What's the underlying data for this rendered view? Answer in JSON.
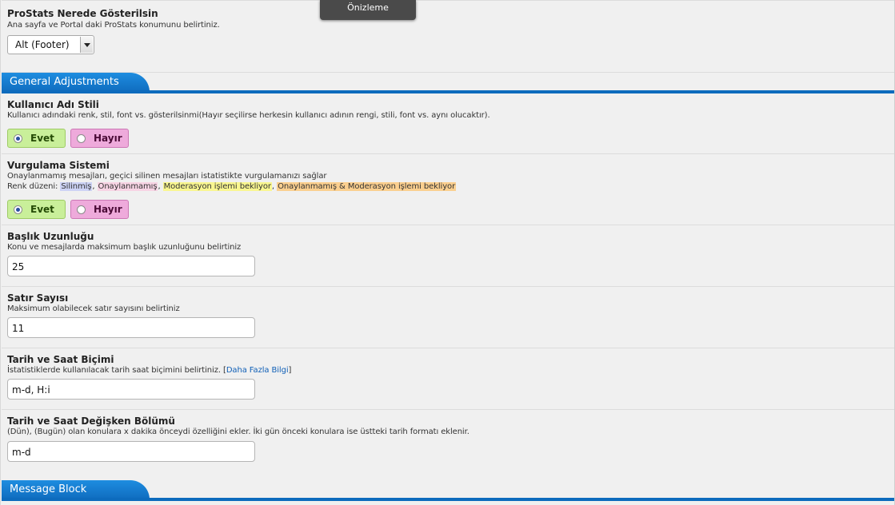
{
  "tooltip": {
    "label": "Önizleme"
  },
  "location_setting": {
    "title": "ProStats Nerede Gösterilsin",
    "desc": "Ana sayfa ve Portal daki ProStats konumunu belirtiniz.",
    "selected": "Alt (Footer)"
  },
  "section_general": {
    "title": "General Adjustments"
  },
  "username_style": {
    "title": "Kullanıcı Adı Stili",
    "desc": "Kullanıcı adındaki renk, stil, font vs. gösterilsinmi(Hayır seçilirse herkesin kullanıcı adının rengi, stili, font vs. aynı olucaktır).",
    "yes_label": "Evet",
    "no_label": "Hayır"
  },
  "highlight_system": {
    "title": "Vurgulama Sistemi",
    "desc": "Onaylanmamış mesajları, geçici silinen mesajları istatistikte vurgulamanızı sağlar",
    "color_prefix": "Renk düzeni: ",
    "color_deleted": "Silinmiş",
    "sep1": ", ",
    "color_unapproved": "Onaylanmamış",
    "sep2": ", ",
    "color_moderation": "Moderasyon işlemi bekliyor",
    "sep3": ", ",
    "color_both": "Onaylanmamış & Moderasyon işlemi bekliyor",
    "yes_label": "Evet",
    "no_label": "Hayır",
    "colors": {
      "deleted": "#cdd3f5",
      "unapproved": "#f7d4e4",
      "moderation": "#f9f690",
      "both": "#fbcf8f"
    }
  },
  "title_length": {
    "title": "Başlık Uzunluğu",
    "desc": "Konu ve mesajlarda maksimum başlık uzunluğunu belirtiniz",
    "value": "25"
  },
  "row_count": {
    "title": "Satır Sayısı",
    "desc": "Maksimum olabilecek satır sayısını belirtiniz",
    "value": "11"
  },
  "date_format": {
    "title": "Tarih ve Saat Biçimi",
    "desc": "İstatistiklerde kullanılacak tarih saat biçimini belirtiniz. ",
    "link_open": "[",
    "link_label": "Daha Fazla Bilgi",
    "link_close": "]",
    "value": "m-d, H:i"
  },
  "date_variable": {
    "title": "Tarih ve Saat Değişken Bölümü",
    "desc": "(Dün), (Bugün) olan konulara x dakika önceydi özelliğini ekler. İki gün önceki konulara ise üstteki tarih formatı eklenir.",
    "value": "m-d"
  },
  "section_message": {
    "title": "Message Block"
  },
  "colors": {
    "accent": "#0d6bbd",
    "yes_bg": "#c9ef9a",
    "no_bg": "#eeaadb"
  }
}
